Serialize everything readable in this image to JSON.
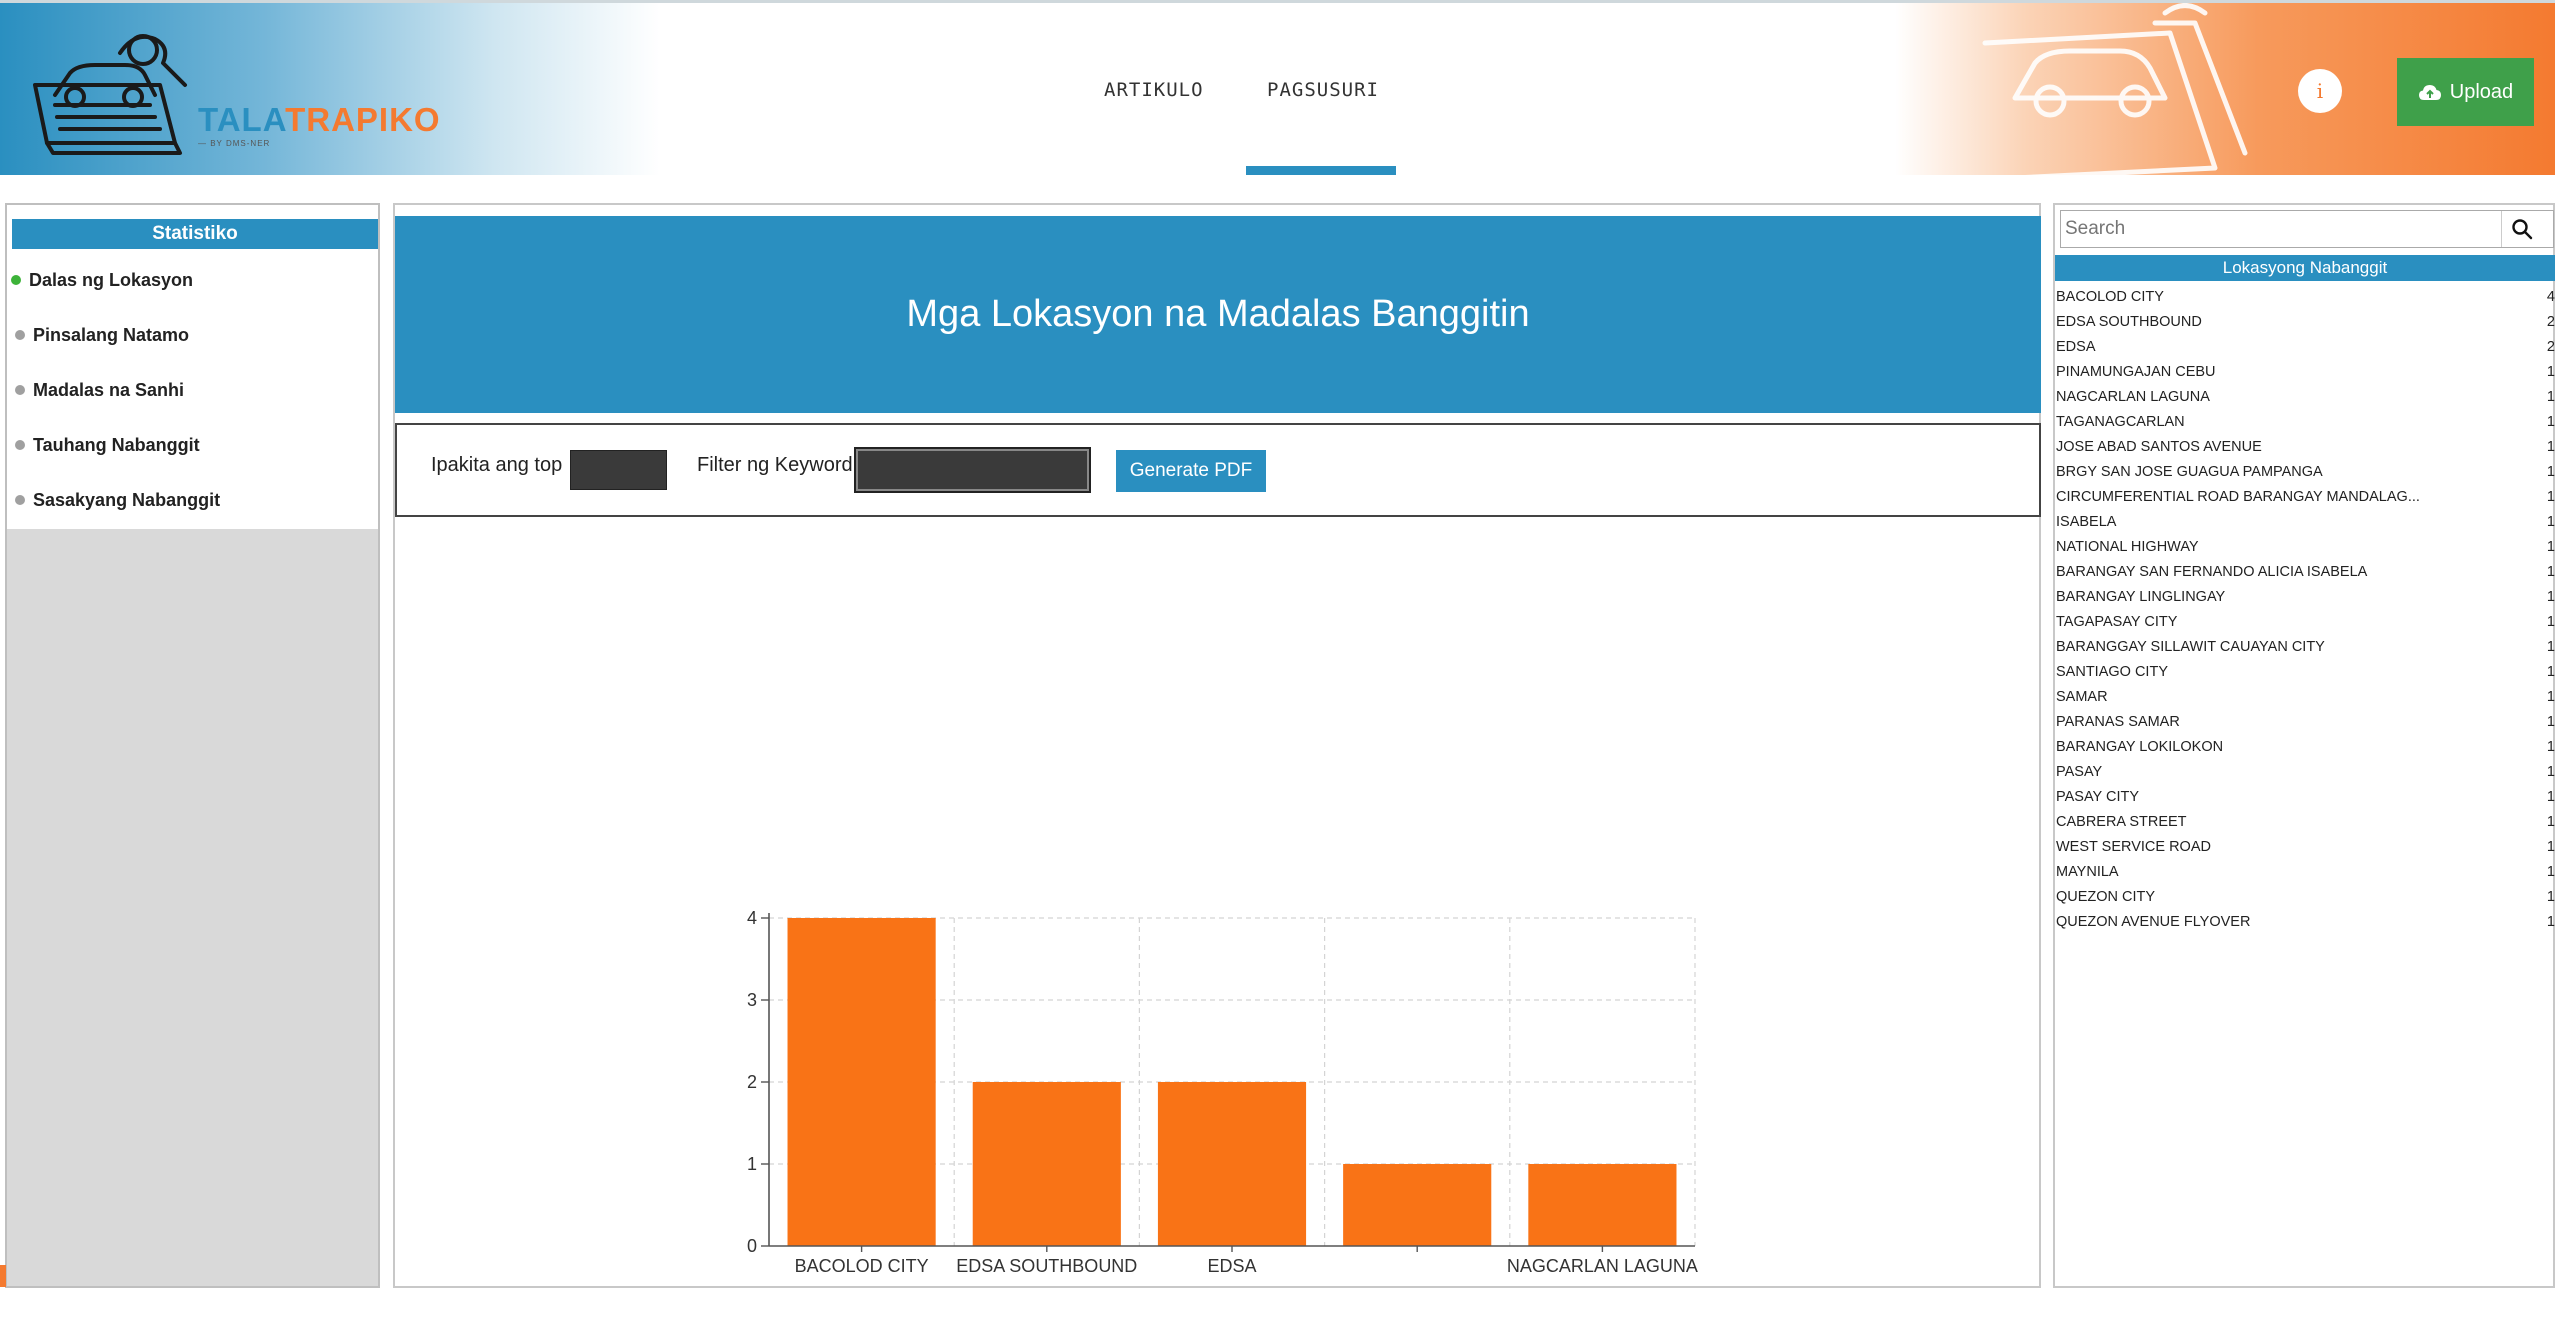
{
  "brand": {
    "name_part1": "TALA",
    "name_part2": "TRAPIKO",
    "tagline": "— BY DMS-NER"
  },
  "nav": {
    "tabs": [
      {
        "label": "ARTIKULO"
      },
      {
        "label": "PAGSUSURI",
        "active": true
      }
    ]
  },
  "header": {
    "info_label": "i",
    "upload_label": "Upload"
  },
  "sidebar": {
    "title": "Statistiko",
    "items": [
      {
        "label": "Dalas ng Lokasyon",
        "active": true
      },
      {
        "label": "Pinsalang Natamo"
      },
      {
        "label": "Madalas na Sanhi"
      },
      {
        "label": "Tauhang Nabanggit"
      },
      {
        "label": "Sasakyang Nabanggit"
      }
    ]
  },
  "main": {
    "title": "Mga Lokasyon na Madalas Banggitin",
    "top_label": "Ipakita ang top",
    "top_value": "",
    "keyword_label": "Filter ng Keyword",
    "keyword_value": "",
    "generate_label": "Generate PDF"
  },
  "chart_data": {
    "type": "bar",
    "categories": [
      "BACOLOD CITY",
      "EDSA SOUTHBOUND",
      "EDSA",
      "PINAMUNGAJAN CEBU",
      "NAGCARLAN LAGUNA"
    ],
    "category_labels_shown": [
      "BACOLOD CITY",
      "EDSA SOUTHBOUND",
      "EDSA",
      "",
      "NAGCARLAN LAGUNA"
    ],
    "values": [
      4,
      2,
      2,
      1,
      1
    ],
    "ylim": [
      0,
      4
    ],
    "yticks": [
      0,
      1,
      2,
      3,
      4
    ],
    "grid": true,
    "bar_color": "#f97316"
  },
  "right_panel": {
    "search_placeholder": "Search",
    "header": "Lokasyong Nabanggit",
    "locations": [
      {
        "name": "BACOLOD CITY",
        "count": "4"
      },
      {
        "name": "EDSA SOUTHBOUND",
        "count": "2"
      },
      {
        "name": "EDSA",
        "count": "2"
      },
      {
        "name": "PINAMUNGAJAN CEBU",
        "count": "1"
      },
      {
        "name": "NAGCARLAN LAGUNA",
        "count": "1"
      },
      {
        "name": "TAGANAGCARLAN",
        "count": "1"
      },
      {
        "name": "JOSE ABAD SANTOS AVENUE",
        "count": "1"
      },
      {
        "name": "BRGY SAN JOSE GUAGUA PAMPANGA",
        "count": "1"
      },
      {
        "name": "CIRCUMFERENTIAL ROAD BARANGAY MANDALAG...",
        "count": "1"
      },
      {
        "name": "ISABELA",
        "count": "1"
      },
      {
        "name": "NATIONAL HIGHWAY",
        "count": "1"
      },
      {
        "name": "BARANGAY SAN FERNANDO ALICIA ISABELA",
        "count": "1"
      },
      {
        "name": "BARANGAY LINGLINGAY",
        "count": "1"
      },
      {
        "name": "TAGAPASAY CITY",
        "count": "1"
      },
      {
        "name": "BARANGGAY SILLAWIT CAUAYAN CITY",
        "count": "1"
      },
      {
        "name": "SANTIAGO CITY",
        "count": "1"
      },
      {
        "name": "SAMAR",
        "count": "1"
      },
      {
        "name": "PARANAS SAMAR",
        "count": "1"
      },
      {
        "name": "BARANGAY LOKILOKON",
        "count": "1"
      },
      {
        "name": "PASAY",
        "count": "1"
      },
      {
        "name": "PASAY CITY",
        "count": "1"
      },
      {
        "name": "CABRERA STREET",
        "count": "1"
      },
      {
        "name": "WEST SERVICE ROAD",
        "count": "1"
      },
      {
        "name": "MAYNILA",
        "count": "1"
      },
      {
        "name": "QUEZON CITY",
        "count": "1"
      },
      {
        "name": "QUEZON AVENUE FLYOVER",
        "count": "1"
      }
    ]
  },
  "colors": {
    "primary": "#2a8fc0",
    "accent": "#f47a30",
    "success": "#3fa04a",
    "bar": "#f97316"
  },
  "icons": {
    "info": "info-icon",
    "upload": "cloud-upload-icon",
    "search": "search-icon",
    "logo": "newspaper-car-icon"
  }
}
